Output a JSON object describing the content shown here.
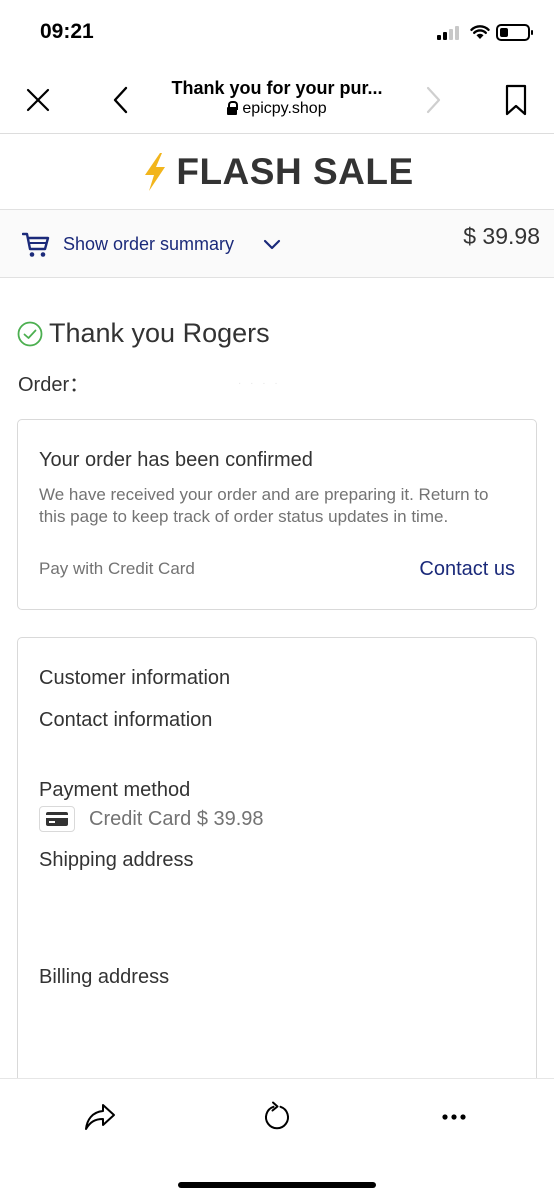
{
  "status_bar": {
    "time": "09:21"
  },
  "browser": {
    "page_title": "Thank you for your pur...",
    "url": "epicpy.shop",
    "icons": [
      "close-icon",
      "back-icon",
      "forward-icon",
      "bookmark-icon"
    ]
  },
  "shop": {
    "name": "FLASH SALE",
    "logo_icon": "lightning-bolt-icon",
    "accent_color": "#f2b51c"
  },
  "order_summary": {
    "toggle_label": "Show order summary",
    "total": "$ 39.98",
    "link_color": "#1b2a7a"
  },
  "main": {
    "thanks": "Thank you Rogers",
    "order_label": "Order：",
    "order_number": "· · · ·",
    "success_color": "#4caf50"
  },
  "confirmation": {
    "title": "Your order has been confirmed",
    "body": "We have received your order and are preparing it. Return to this page to keep track of order status updates in time.",
    "pay_with": "Pay with Credit Card",
    "contact_label": "Contact us"
  },
  "customer_info": {
    "heading": "Customer information",
    "contact_heading": "Contact information",
    "payment_heading": "Payment method",
    "payment_text": "Credit Card $ 39.98",
    "shipping_heading": "Shipping address",
    "billing_heading": "Billing address"
  },
  "toolbar": {
    "icons": [
      "share-icon",
      "reload-icon",
      "more-icon"
    ]
  }
}
